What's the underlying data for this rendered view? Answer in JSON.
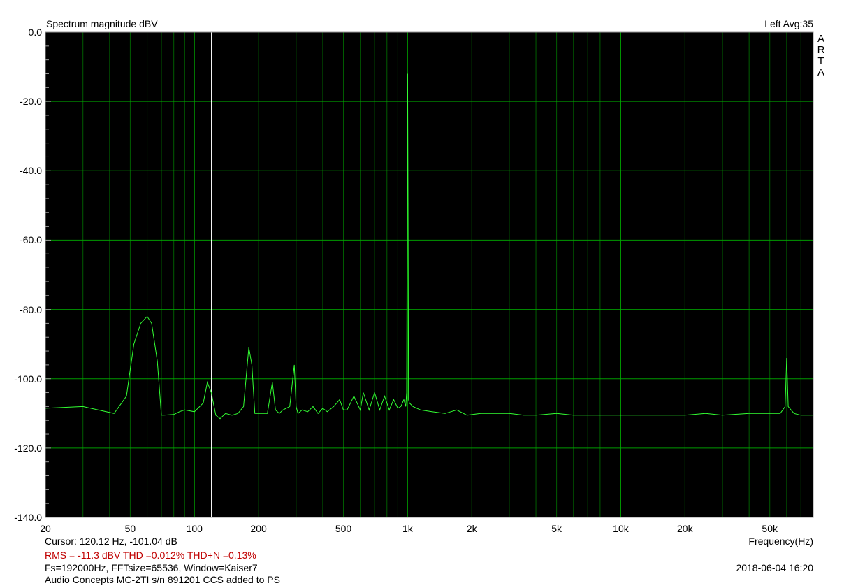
{
  "header": {
    "title": "Spectrum magnitude dBV",
    "channel_info": "Left  Avg:35",
    "logo": "ARTA"
  },
  "footer": {
    "cursor": "Cursor: 120.12 Hz, -101.04 dB",
    "measurements": "RMS =  -11.3 dBV   THD =0.012%   THD+N =0.13%",
    "settings": "Fs=192000Hz, FFTsize=65536, Window=Kaiser7",
    "device": "Audio Concepts MC-2TI  s/n 891201 CCS added to PS",
    "date": "2018-06-04  16:20",
    "xaxis_label": "Frequency(Hz)"
  },
  "colors": {
    "plot_background": "#000000",
    "grid": "#00aa00",
    "trace": "#33ff33",
    "cursor": "#ffffff",
    "measurement_text": "#c00000"
  },
  "chart_data": {
    "type": "line",
    "title": "Spectrum magnitude dBV",
    "xlabel": "Frequency(Hz)",
    "ylabel": "",
    "xscale": "log",
    "xlim": [
      20,
      80000
    ],
    "ylim": [
      -140,
      0
    ],
    "grid": true,
    "y_ticks": [
      "0.0",
      "-20.0",
      "-40.0",
      "-60.0",
      "-80.0",
      "-100.0",
      "-120.0",
      "-140.0"
    ],
    "x_ticks": [
      {
        "value": 20,
        "label": "20"
      },
      {
        "value": 50,
        "label": "50"
      },
      {
        "value": 100,
        "label": "100"
      },
      {
        "value": 200,
        "label": "200"
      },
      {
        "value": 500,
        "label": "500"
      },
      {
        "value": 1000,
        "label": "1k"
      },
      {
        "value": 2000,
        "label": "2k"
      },
      {
        "value": 5000,
        "label": "5k"
      },
      {
        "value": 10000,
        "label": "10k"
      },
      {
        "value": 20000,
        "label": "20k"
      },
      {
        "value": 50000,
        "label": "50k"
      }
    ],
    "cursor": {
      "x": 120.12,
      "y": -101.04
    },
    "series": [
      {
        "x": [
          20,
          30,
          42,
          48,
          52,
          56,
          60,
          63,
          67,
          70,
          72,
          80,
          85,
          90,
          100,
          110,
          115,
          120,
          126,
          132,
          140,
          150,
          160,
          170,
          180,
          186,
          192,
          200,
          220,
          232,
          240,
          250,
          260,
          280,
          294,
          300,
          306,
          320,
          340,
          360,
          380,
          400,
          420,
          450,
          480,
          500,
          520,
          560,
          600,
          620,
          660,
          700,
          740,
          780,
          820,
          860,
          900,
          930,
          960,
          980,
          990,
          995,
          1000,
          1005,
          1010,
          1020,
          1060,
          1150,
          1300,
          1500,
          1700,
          1900,
          2200,
          2600,
          3000,
          3500,
          4000,
          5000,
          6000,
          7000,
          8000,
          10000,
          12000,
          15000,
          20000,
          25000,
          30000,
          40000,
          50000,
          56000,
          59000,
          60000,
          61000,
          65000,
          70000,
          80000
        ],
        "y": [
          -108.5,
          -108,
          -110,
          -105,
          -90,
          -84,
          -82,
          -84,
          -95,
          -110.5,
          -110.5,
          -110.3,
          -109.5,
          -109,
          -109.5,
          -107,
          -101,
          -104,
          -110.5,
          -111.5,
          -110,
          -110.5,
          -110,
          -108,
          -91,
          -96,
          -110,
          -110,
          -110,
          -101,
          -109,
          -110,
          -109,
          -108,
          -96,
          -108,
          -110,
          -109,
          -109.5,
          -108,
          -110,
          -108.5,
          -109.5,
          -108,
          -106,
          -109,
          -109,
          -105,
          -109,
          -104,
          -109,
          -104,
          -109,
          -105,
          -109,
          -106,
          -108.5,
          -108,
          -106,
          -108,
          -104,
          -60,
          -12,
          -50,
          -106,
          -107,
          -108,
          -109,
          -109.5,
          -110,
          -109,
          -110.5,
          -110,
          -110,
          -110,
          -110.5,
          -110.5,
          -110,
          -110.5,
          -110.5,
          -110.5,
          -110.5,
          -110.5,
          -110.5,
          -110.5,
          -110,
          -110.5,
          -110,
          -110,
          -110,
          -108,
          -94,
          -108,
          -110,
          -110.5,
          -110.5
        ]
      }
    ]
  }
}
